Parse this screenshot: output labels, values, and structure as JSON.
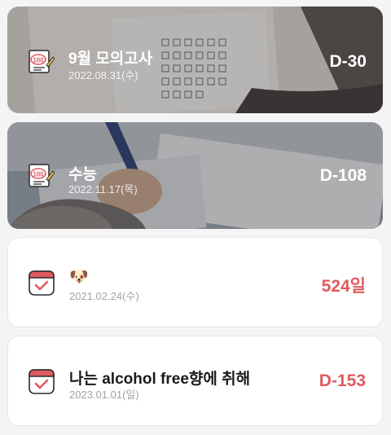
{
  "events": [
    {
      "title": "9월 모의고사",
      "date": "2022.08.31(수)",
      "count": "D-30",
      "icon": "exam-100-icon"
    },
    {
      "title": "수능",
      "date": "2022.11.17(목)",
      "count": "D-108",
      "icon": "exam-100-icon"
    },
    {
      "title": "🐶",
      "date": "2021.02.24(수)",
      "count": "524일",
      "icon": "calendar-check-icon"
    },
    {
      "title": "나는 alcohol free향에 취해",
      "date": "2023.01.01(일)",
      "count": "D-153",
      "icon": "calendar-check-icon"
    }
  ],
  "colors": {
    "accent": "#e05a5f",
    "date_gray": "#a3a3a3",
    "background": "#f4f4f4"
  }
}
